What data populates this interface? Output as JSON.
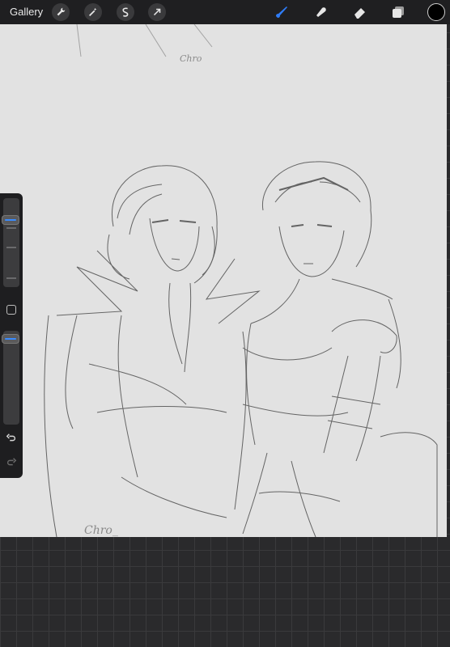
{
  "toolbar": {
    "gallery_label": "Gallery",
    "left_tools": [
      "wrench-icon",
      "magic-wand-icon",
      "selection-icon",
      "transform-arrow-icon"
    ],
    "right_tools": [
      "brush-icon",
      "smudge-icon",
      "eraser-icon",
      "layers-icon"
    ],
    "active_tool": "brush-icon",
    "active_color": "#000000",
    "accent": "#2f7cf6"
  },
  "canvas": {
    "signatures": [
      "Chro_",
      "Chro"
    ]
  },
  "sidebar": {
    "brush_size_level": 0.78,
    "opacity_level": 0.95,
    "undo_icon": "undo-icon",
    "redo_icon": "redo-icon"
  }
}
